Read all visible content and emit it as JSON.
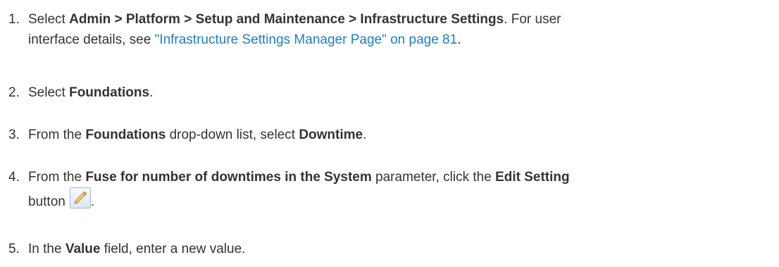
{
  "steps": [
    {
      "number": "1.",
      "line1_pre": "Select ",
      "line1_bold": "Admin > Platform > Setup and Maintenance > Infrastructure Settings",
      "line1_post": ". For user",
      "line2_pre": "interface details, see ",
      "link_text": "\"Infrastructure Settings Manager Page\" on page 81",
      "line2_post": "."
    },
    {
      "number": "2.",
      "pre": "Select ",
      "bold": "Foundations",
      "post": "."
    },
    {
      "number": "3.",
      "pre": "From the ",
      "bold1": "Foundations",
      "mid": " drop-down list, select ",
      "bold2": "Downtime",
      "post": "."
    },
    {
      "number": "4.",
      "pre": "From the ",
      "bold1": "Fuse for number of downtimes in the System",
      "mid": " parameter, click the ",
      "bold2": "Edit Setting",
      "line2_pre": "button",
      "line2_post": ".",
      "icon": "pencil-icon"
    },
    {
      "number": "5.",
      "pre": "In the ",
      "bold": "Value",
      "post": " field, enter a new value."
    }
  ],
  "colors": {
    "text": "#333333",
    "link": "#1f7fc0"
  }
}
